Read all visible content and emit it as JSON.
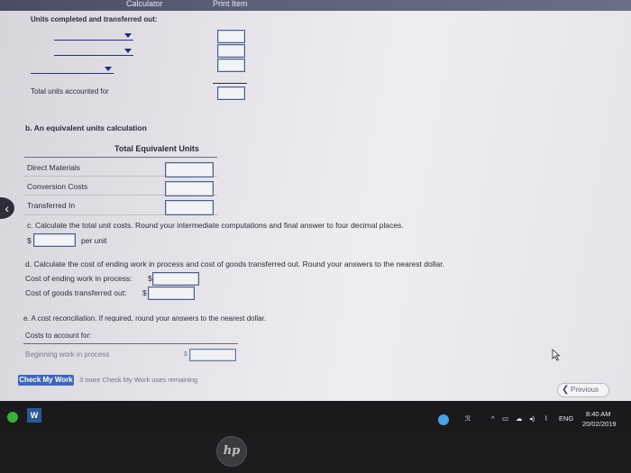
{
  "topbar": {
    "calculator": "Calculator",
    "print_item": "Print Item"
  },
  "section_a": {
    "units_completed_label": "Units completed and transferred out:",
    "total_units_label": "Total units accounted for"
  },
  "section_b": {
    "title": "b. An equivalent units calculation",
    "column_header": "Total Equivalent Units",
    "rows": [
      "Direct Materials",
      "Conversion Costs",
      "Transferred In"
    ]
  },
  "section_c": {
    "text": "c. Calculate the total unit costs. Round your intermediate computations and final answer to four decimal places.",
    "currency": "$",
    "suffix": "per unit"
  },
  "section_d": {
    "text": "d. Calculate the cost of ending work in process and cost of goods transferred out. Round your answers to the nearest dollar.",
    "ending_wip_label": "Cost of ending work in process:",
    "transferred_label": "Cost of goods transferred out:",
    "currency": "$"
  },
  "section_e": {
    "text": "e. A cost reconciliation. If required, round your answers to the nearest dollar.",
    "costs_label": "Costs to account for:",
    "beginning_wip_label": "Beginning work in process",
    "currency": "$"
  },
  "footer": {
    "check_button": "Check My Work",
    "remaining_text": "3 more Check My Work uses remaining",
    "previous_button": "Previous"
  },
  "taskbar": {
    "lang": "ENG",
    "time": "8:40 AM",
    "date": "20/02/2019"
  },
  "bezel": {
    "logo": "hp"
  },
  "colors": {
    "accent": "#3d67b8",
    "input_border": "#4e5f86",
    "taskbar": "#1a1a1d"
  }
}
